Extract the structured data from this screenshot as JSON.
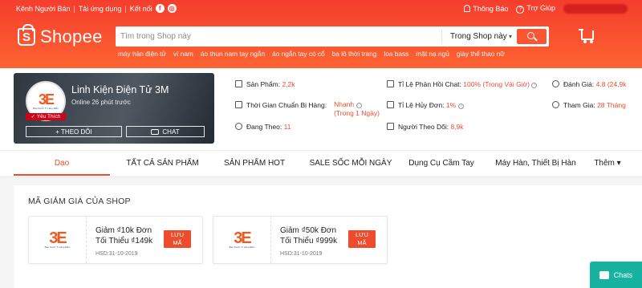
{
  "topbar": {
    "seller_center": "Kênh Người Bán",
    "download_app": "Tải ứng dụng",
    "connect": "Kết nối",
    "notifications": "Thông Báo",
    "help": "Trợ Giúp"
  },
  "header": {
    "logo": "Shopee",
    "search_placeholder": "Tìm trong Shop này",
    "search_scope": "Trong Shop này",
    "keywords": [
      "máy hàn điện tử",
      "ví nam",
      "áo thun nam tay ngắn",
      "áo ngắn tay có cổ",
      "ba lô thời trang",
      "loa bass",
      "mặt nạ ngủ",
      "giày thể thao nữ"
    ]
  },
  "shop": {
    "name": "Linh Kiện Điện Tử 3M",
    "online": "Online 26 phút trước",
    "favorite_badge": "✓ Yêu Thích",
    "follow_label": "+ THEO DÕI",
    "chat_label": "CHAT",
    "stats": {
      "products_label": "Sản Phẩm:",
      "products_value": "2,2k",
      "prep_label": "Thời Gian Chuẩn Bị Hàng:",
      "prep_value": "Nhanh",
      "prep_note": "(Trong 1 Ngày)",
      "following_label": "Đang Theo:",
      "following_value": "11",
      "response_label": "Tỉ Lệ Phản Hồi Chat:",
      "response_value": "100% (Trong Vài Giờ)",
      "cancel_label": "Tỉ Lệ Hủy Đơn:",
      "cancel_value": "1%",
      "followers_label": "Người Theo Dõi:",
      "followers_value": "8,9k",
      "rating_label": "Đánh Giá:",
      "rating_value": "4.8 (24,9k",
      "joined_label": "Tham Gia:",
      "joined_value": "28 Tháng"
    }
  },
  "nav": {
    "tabs": [
      "Dạo",
      "TẤT CẢ SẢN PHẨM",
      "SẢN PHẨM HOT",
      "SALE SỐC MỖI NGÀY",
      "Dụng Cụ Cầm Tay",
      "Máy Hàn, Thiết Bị Hàn",
      "Thêm ▾"
    ]
  },
  "vouchers": {
    "title": "MÃ GIẢM GIÁ CỦA SHOP",
    "items": [
      {
        "line1": "Giảm ₫10k Đơn",
        "line2": "Tối Thiểu ₫149k",
        "expiry": "HSD:31-10-2019",
        "button_1": "LƯU",
        "button_2": "MÃ"
      },
      {
        "line1": "Giảm ₫50k Đơn",
        "line2": "Tối Thiểu ₫999k",
        "expiry": "HSD:31-10-2019",
        "button_1": "LƯU",
        "button_2": "MÃ"
      }
    ],
    "logo_mark": "3E",
    "logo_sub": "Bao Nước Tì Lăng Điền"
  },
  "chat_widget": {
    "label": "Chats"
  },
  "colors": {
    "brand": "#ee4d2d",
    "chat": "#18b2a1"
  }
}
